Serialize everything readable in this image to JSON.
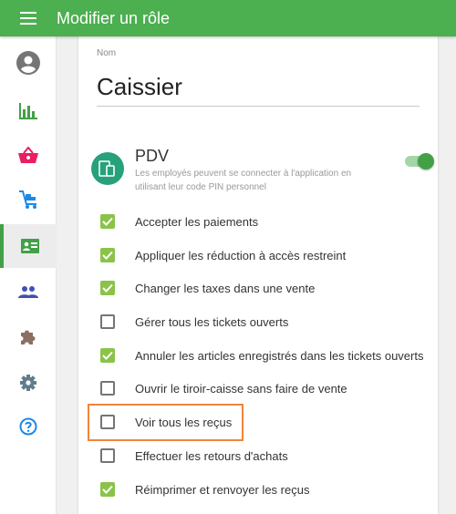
{
  "header": {
    "title": "Modifier un rôle",
    "menu_icon": "menu-icon"
  },
  "sidebar": {
    "active_color": "#43a047",
    "items": [
      {
        "name": "profile",
        "icon": "account-circle-icon"
      },
      {
        "name": "reports",
        "icon": "bar-chart-icon"
      },
      {
        "name": "items",
        "icon": "basket-icon"
      },
      {
        "name": "inventory",
        "icon": "cart-icon"
      },
      {
        "name": "employees",
        "icon": "badge-icon",
        "active": true
      },
      {
        "name": "customers",
        "icon": "people-icon"
      },
      {
        "name": "integrations",
        "icon": "puzzle-icon"
      },
      {
        "name": "settings",
        "icon": "gear-icon"
      },
      {
        "name": "help",
        "icon": "help-icon"
      }
    ]
  },
  "form": {
    "name_label": "Nom",
    "name_value": "Caissier",
    "pdv": {
      "title": "PDV",
      "description": "Les employés peuvent se connecter à l'application en utilisant leur code PIN personnel",
      "enabled": true
    },
    "permissions": [
      {
        "label": "Accepter les paiements",
        "checked": true
      },
      {
        "label": "Appliquer les réduction à accès restreint",
        "checked": true
      },
      {
        "label": "Changer les taxes dans une vente",
        "checked": true
      },
      {
        "label": "Gérer tous les tickets ouverts",
        "checked": false
      },
      {
        "label": "Annuler les articles enregistrés dans les tickets ouverts",
        "checked": true
      },
      {
        "label": "Ouvrir le tiroir-caisse sans faire de vente",
        "checked": false
      },
      {
        "label": "Voir tous les reçus",
        "checked": false
      },
      {
        "label": "Effectuer les retours d'achats",
        "checked": false
      },
      {
        "label": "Réimprimer et renvoyer les reçus",
        "checked": true
      }
    ]
  },
  "colors": {
    "brand": "#4caf50",
    "checkbox_on": "#8bc34a",
    "highlight": "#f0843c",
    "pdv_icon": "#26a17b"
  }
}
